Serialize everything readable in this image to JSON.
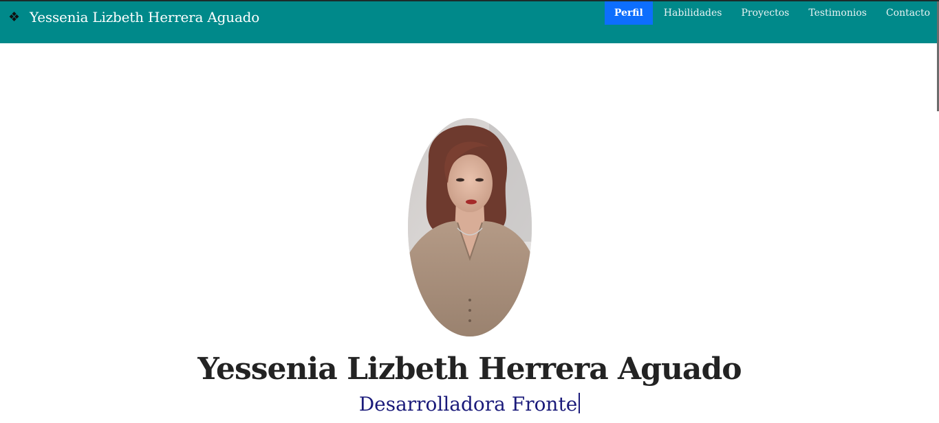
{
  "header": {
    "brand_name": "Yessenia Lizbeth Herrera Aguado",
    "brand_icon": "diamond-ornament-icon",
    "bg_color": "#00898a"
  },
  "nav": {
    "items": [
      {
        "label": "Perfil",
        "active": true
      },
      {
        "label": "Habilidades",
        "active": false
      },
      {
        "label": "Proyectos",
        "active": false
      },
      {
        "label": "Testimonios",
        "active": false
      },
      {
        "label": "Contacto",
        "active": false
      }
    ],
    "active_color": "#0d6efd"
  },
  "hero": {
    "name": "Yessenia Lizbeth Herrera Aguado",
    "role": "Desarrolladora Fronte"
  }
}
